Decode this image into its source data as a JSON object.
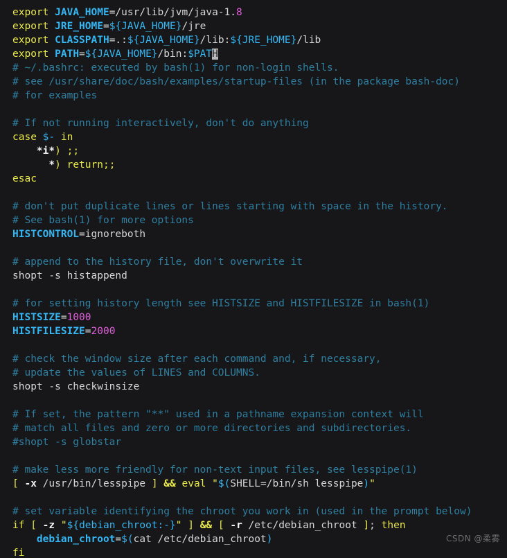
{
  "editor": {
    "background_color": "#17171a",
    "cursor_color": "#b9b9b9",
    "palette": {
      "keyword": "#e8e84a",
      "variable": "#35b6f2",
      "expansion": "#35b6f2",
      "plain": "#d6d6d6",
      "comment": "#2f7fa0",
      "number": "#e05fd8",
      "operator": "#e8e84a"
    }
  },
  "watermark": {
    "text": "CSDN @柔雾"
  },
  "lines": [
    {
      "n": 1,
      "text": "export JAVA_HOME=/usr/lib/jvm/java-1.8"
    },
    {
      "n": 2,
      "text": "export JRE_HOME=${JAVA_HOME}/jre"
    },
    {
      "n": 3,
      "text": "export CLASSPATH=.:${JAVA_HOME}/lib:${JRE_HOME}/lib"
    },
    {
      "n": 4,
      "text": "export PATH=${JAVA_HOME}/bin:$PATH"
    },
    {
      "n": 5,
      "text": "# ~/.bashrc: executed by bash(1) for non-login shells."
    },
    {
      "n": 6,
      "text": "# see /usr/share/doc/bash/examples/startup-files (in the package bash-doc)"
    },
    {
      "n": 7,
      "text": "# for examples"
    },
    {
      "n": 8,
      "text": ""
    },
    {
      "n": 9,
      "text": "# If not running interactively, don't do anything"
    },
    {
      "n": 10,
      "text": "case $- in"
    },
    {
      "n": 11,
      "text": "    *i*) ;;"
    },
    {
      "n": 12,
      "text": "      *) return;;"
    },
    {
      "n": 13,
      "text": "esac"
    },
    {
      "n": 14,
      "text": ""
    },
    {
      "n": 15,
      "text": "# don't put duplicate lines or lines starting with space in the history."
    },
    {
      "n": 16,
      "text": "# See bash(1) for more options"
    },
    {
      "n": 17,
      "text": "HISTCONTROL=ignoreboth"
    },
    {
      "n": 18,
      "text": ""
    },
    {
      "n": 19,
      "text": "# append to the history file, don't overwrite it"
    },
    {
      "n": 20,
      "text": "shopt -s histappend"
    },
    {
      "n": 21,
      "text": ""
    },
    {
      "n": 22,
      "text": "# for setting history length see HISTSIZE and HISTFILESIZE in bash(1)"
    },
    {
      "n": 23,
      "text": "HISTSIZE=1000"
    },
    {
      "n": 24,
      "text": "HISTFILESIZE=2000"
    },
    {
      "n": 25,
      "text": ""
    },
    {
      "n": 26,
      "text": "# check the window size after each command and, if necessary,"
    },
    {
      "n": 27,
      "text": "# update the values of LINES and COLUMNS."
    },
    {
      "n": 28,
      "text": "shopt -s checkwinsize"
    },
    {
      "n": 29,
      "text": ""
    },
    {
      "n": 30,
      "text": "# If set, the pattern \"**\" used in a pathname expansion context will"
    },
    {
      "n": 31,
      "text": "# match all files and zero or more directories and subdirectories."
    },
    {
      "n": 32,
      "text": "#shopt -s globstar"
    },
    {
      "n": 33,
      "text": ""
    },
    {
      "n": 34,
      "text": "# make less more friendly for non-text input files, see lesspipe(1)"
    },
    {
      "n": 35,
      "text": "[ -x /usr/bin/lesspipe ] && eval \"$(SHELL=/bin/sh lesspipe)\""
    },
    {
      "n": 36,
      "text": ""
    },
    {
      "n": 37,
      "text": "# set variable identifying the chroot you work in (used in the prompt below)"
    },
    {
      "n": 38,
      "text": "if [ -z \"${debian_chroot:-}\" ] && [ -r /etc/debian_chroot ]; then"
    },
    {
      "n": 39,
      "text": "    debian_chroot=$(cat /etc/debian_chroot)"
    },
    {
      "n": 40,
      "text": "fi"
    }
  ],
  "tokens": {
    "l1": [
      {
        "t": "export",
        "c": "kw"
      },
      {
        "t": " ",
        "c": "txt"
      },
      {
        "t": "JAVA_HOME",
        "c": "var"
      },
      {
        "t": "=/usr/lib/jvm/java-1.",
        "c": "txt"
      },
      {
        "t": "8",
        "c": "num"
      }
    ],
    "l2": [
      {
        "t": "export",
        "c": "kw"
      },
      {
        "t": " ",
        "c": "txt"
      },
      {
        "t": "JRE_HOME",
        "c": "var"
      },
      {
        "t": "=",
        "c": "txt"
      },
      {
        "t": "${JAVA_HOME}",
        "c": "exp"
      },
      {
        "t": "/jre",
        "c": "txt"
      }
    ],
    "l3": [
      {
        "t": "export",
        "c": "kw"
      },
      {
        "t": " ",
        "c": "txt"
      },
      {
        "t": "CLASSPATH",
        "c": "var"
      },
      {
        "t": "=.:",
        "c": "txt"
      },
      {
        "t": "${JAVA_HOME}",
        "c": "exp"
      },
      {
        "t": "/lib:",
        "c": "txt"
      },
      {
        "t": "${JRE_HOME}",
        "c": "exp"
      },
      {
        "t": "/lib",
        "c": "txt"
      }
    ],
    "l4": [
      {
        "t": "export",
        "c": "kw"
      },
      {
        "t": " ",
        "c": "txt"
      },
      {
        "t": "PATH",
        "c": "var"
      },
      {
        "t": "=",
        "c": "txt"
      },
      {
        "t": "${JAVA_HOME}",
        "c": "exp"
      },
      {
        "t": "/bin:",
        "c": "txt"
      },
      {
        "t": "$PAT",
        "c": "exp"
      },
      {
        "t": "H",
        "c": "cur"
      }
    ],
    "l5": [
      {
        "t": "# ~/.bashrc: executed by bash(1) for non-login shells.",
        "c": "cmt"
      }
    ],
    "l6": [
      {
        "t": "# see /usr/share/doc/bash/examples/startup-files (in the package bash-doc)",
        "c": "cmt"
      }
    ],
    "l7": [
      {
        "t": "# for examples",
        "c": "cmt"
      }
    ],
    "l9": [
      {
        "t": "# If not running interactively, don't do anything",
        "c": "cmt"
      }
    ],
    "l10": [
      {
        "t": "case",
        "c": "kw"
      },
      {
        "t": " ",
        "c": "txt"
      },
      {
        "t": "$-",
        "c": "exp"
      },
      {
        "t": " ",
        "c": "txt"
      },
      {
        "t": "in",
        "c": "kw"
      }
    ],
    "l11": [
      {
        "t": "    ",
        "c": "txt"
      },
      {
        "t": "*i*",
        "c": "txtb"
      },
      {
        "t": ")",
        "c": "op"
      },
      {
        "t": " ",
        "c": "txt"
      },
      {
        "t": ";;",
        "c": "op"
      }
    ],
    "l12": [
      {
        "t": "      ",
        "c": "txt"
      },
      {
        "t": "*",
        "c": "txtb"
      },
      {
        "t": ")",
        "c": "op"
      },
      {
        "t": " ",
        "c": "txt"
      },
      {
        "t": "return",
        "c": "kw"
      },
      {
        "t": ";;",
        "c": "op"
      }
    ],
    "l13": [
      {
        "t": "esac",
        "c": "kw"
      }
    ],
    "l15": [
      {
        "t": "# don't put duplicate lines or lines starting with space in the history.",
        "c": "cmt"
      }
    ],
    "l16": [
      {
        "t": "# See bash(1) for more options",
        "c": "cmt"
      }
    ],
    "l17": [
      {
        "t": "HISTCONTROL",
        "c": "var"
      },
      {
        "t": "=ignoreboth",
        "c": "txt"
      }
    ],
    "l19": [
      {
        "t": "# append to the history file, don't overwrite it",
        "c": "cmt"
      }
    ],
    "l20": [
      {
        "t": "shopt -s histappend",
        "c": "txt"
      }
    ],
    "l22": [
      {
        "t": "# for setting history length see HISTSIZE and HISTFILESIZE in bash(1)",
        "c": "cmt"
      }
    ],
    "l23": [
      {
        "t": "HISTSIZE",
        "c": "var"
      },
      {
        "t": "=",
        "c": "txt"
      },
      {
        "t": "1000",
        "c": "num"
      }
    ],
    "l24": [
      {
        "t": "HISTFILESIZE",
        "c": "var"
      },
      {
        "t": "=",
        "c": "txt"
      },
      {
        "t": "2000",
        "c": "num"
      }
    ],
    "l26": [
      {
        "t": "# check the window size after each command and, if necessary,",
        "c": "cmt"
      }
    ],
    "l27": [
      {
        "t": "# update the values of LINES and COLUMNS.",
        "c": "cmt"
      }
    ],
    "l28": [
      {
        "t": "shopt -s checkwinsize",
        "c": "txt"
      }
    ],
    "l30": [
      {
        "t": "# If set, the pattern \"**\" used in a pathname expansion context will",
        "c": "cmt"
      }
    ],
    "l31": [
      {
        "t": "# match all files and zero or more directories and subdirectories.",
        "c": "cmt"
      }
    ],
    "l32": [
      {
        "t": "#shopt -s globstar",
        "c": "cmt"
      }
    ],
    "l34": [
      {
        "t": "# make less more friendly for non-text input files, see lesspipe(1)",
        "c": "cmt"
      }
    ],
    "l35": [
      {
        "t": "[",
        "c": "op"
      },
      {
        "t": " ",
        "c": "txt"
      },
      {
        "t": "-x",
        "c": "txtb"
      },
      {
        "t": " /usr/bin/lesspipe ",
        "c": "txt"
      },
      {
        "t": "]",
        "c": "op"
      },
      {
        "t": " ",
        "c": "txt"
      },
      {
        "t": "&&",
        "c": "opb"
      },
      {
        "t": " ",
        "c": "txt"
      },
      {
        "t": "eval",
        "c": "kw"
      },
      {
        "t": " ",
        "c": "txt"
      },
      {
        "t": "\"",
        "c": "str"
      },
      {
        "t": "$(",
        "c": "exp"
      },
      {
        "t": "SHELL=/bin/sh lesspipe",
        "c": "txt"
      },
      {
        "t": ")",
        "c": "exp"
      },
      {
        "t": "\"",
        "c": "str"
      }
    ],
    "l37": [
      {
        "t": "# set variable identifying the chroot you work in (used in the prompt below)",
        "c": "cmt"
      }
    ],
    "l38": [
      {
        "t": "if",
        "c": "kw"
      },
      {
        "t": " ",
        "c": "txt"
      },
      {
        "t": "[",
        "c": "op"
      },
      {
        "t": " ",
        "c": "txt"
      },
      {
        "t": "-z",
        "c": "txtb"
      },
      {
        "t": " ",
        "c": "txt"
      },
      {
        "t": "\"",
        "c": "str"
      },
      {
        "t": "${debian_chroot:-}",
        "c": "exp"
      },
      {
        "t": "\"",
        "c": "str"
      },
      {
        "t": " ",
        "c": "txt"
      },
      {
        "t": "]",
        "c": "op"
      },
      {
        "t": " ",
        "c": "txt"
      },
      {
        "t": "&&",
        "c": "opb"
      },
      {
        "t": " ",
        "c": "txt"
      },
      {
        "t": "[",
        "c": "op"
      },
      {
        "t": " ",
        "c": "txt"
      },
      {
        "t": "-r",
        "c": "txtb"
      },
      {
        "t": " /etc/debian_chroot ",
        "c": "txt"
      },
      {
        "t": "]",
        "c": "op"
      },
      {
        "t": ";",
        "c": "txt"
      },
      {
        "t": " ",
        "c": "txt"
      },
      {
        "t": "then",
        "c": "kw"
      }
    ],
    "l39": [
      {
        "t": "    ",
        "c": "txt"
      },
      {
        "t": "debian_chroot",
        "c": "var"
      },
      {
        "t": "=",
        "c": "txt"
      },
      {
        "t": "$(",
        "c": "exp"
      },
      {
        "t": "cat /etc/debian_chroot",
        "c": "txt"
      },
      {
        "t": ")",
        "c": "exp"
      }
    ],
    "l40": [
      {
        "t": "fi",
        "c": "kw"
      }
    ]
  }
}
